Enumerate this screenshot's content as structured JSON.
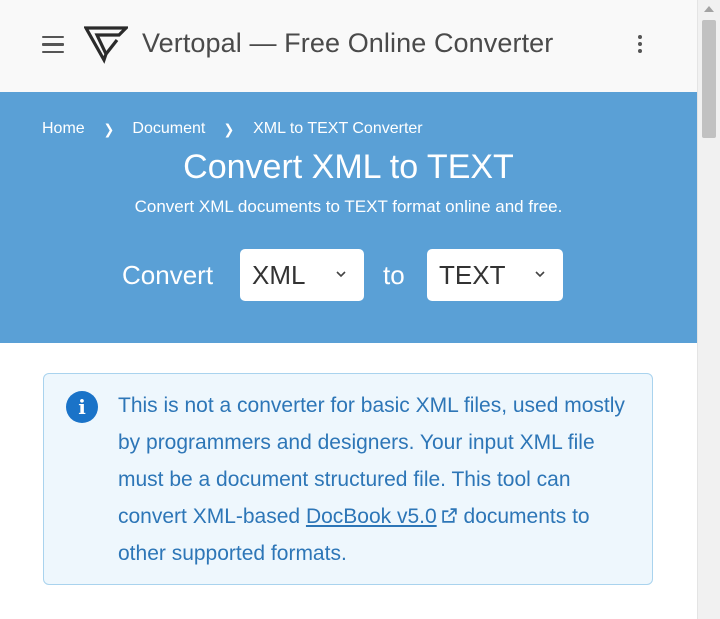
{
  "header": {
    "menu_icon": "hamburger-menu-icon",
    "logo_icon": "vertopal-logo-icon",
    "title": "Vertopal — Free Online Converter",
    "more_icon": "more-vertical-icon"
  },
  "breadcrumb": {
    "items": [
      "Home",
      "Document",
      "XML to TEXT Converter"
    ],
    "separator_icon": "chevron-right-icon"
  },
  "hero": {
    "title": "Convert XML to TEXT",
    "subtitle": "Convert XML documents to TEXT format online and free.",
    "convert_label": "Convert",
    "to_label": "to",
    "from_format": "XML",
    "to_format": "TEXT",
    "background_color": "#5aa0d6"
  },
  "alert": {
    "icon": "info-circle-icon",
    "text_before_link": "This is not a converter for basic XML files, used mostly by programmers and designers. Your input XML file must be a document structured file. This tool can convert XML-based ",
    "link_text": "DocBook v5.0",
    "link_icon": "external-link-icon",
    "text_after_link": " documents to other supported formats.",
    "text_color": "#2d76b7",
    "background_color": "#eef7fd"
  }
}
